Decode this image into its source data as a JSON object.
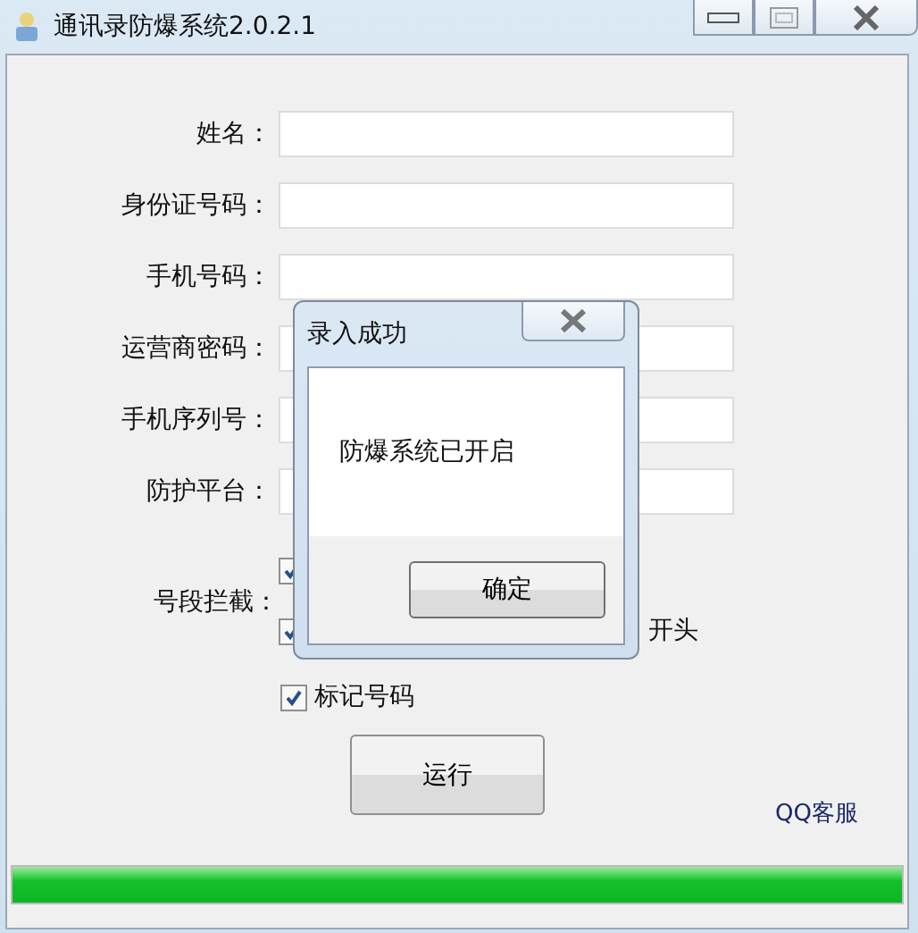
{
  "window": {
    "title": "通讯录防爆系统2.0.2.1"
  },
  "fields": [
    {
      "label": "姓名："
    },
    {
      "label": "身份证号码："
    },
    {
      "label": "手机号码："
    },
    {
      "label": "运营商密码："
    },
    {
      "label": "手机序列号："
    },
    {
      "label": "防护平台："
    }
  ],
  "interception": {
    "label": "号段拦截：",
    "options": [
      {
        "checked": true
      },
      {
        "label": "开头",
        "checked": true
      }
    ]
  },
  "mark_number": {
    "label": "标记号码",
    "checked": true
  },
  "run_button": "运行",
  "support_link": "QQ客服",
  "progress": {
    "level": 1
  },
  "dialog": {
    "title": "录入成功",
    "message": "防爆系统已开启",
    "ok_button": "确定"
  }
}
